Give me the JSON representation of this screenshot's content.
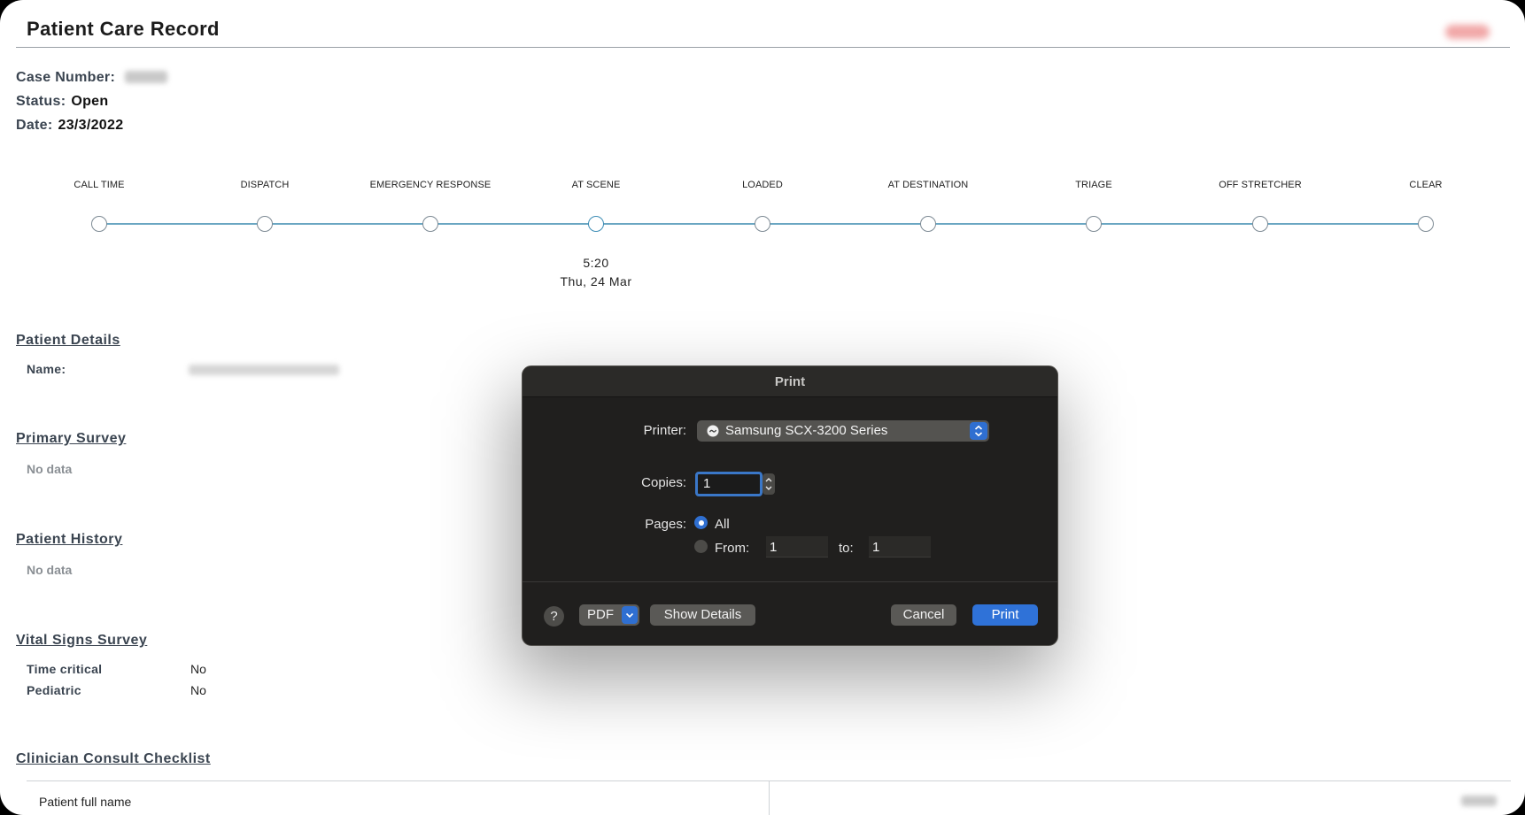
{
  "header": {
    "title": "Patient Care Record"
  },
  "case": {
    "case_number_label": "Case Number:",
    "status_label": "Status:",
    "status_value": "Open",
    "date_label": "Date:",
    "date_value": "23/3/2022"
  },
  "timeline": {
    "stages": [
      "CALL TIME",
      "DISPATCH",
      "EMERGENCY RESPONSE",
      "AT SCENE",
      "LOADED",
      "AT DESTINATION",
      "TRIAGE",
      "OFF STRETCHER",
      "CLEAR"
    ],
    "active_stage": "AT SCENE",
    "active_time": "5:20",
    "active_date": "Thu, 24 Mar"
  },
  "sections": {
    "patient_details": {
      "heading": "Patient Details",
      "name_label": "Name:"
    },
    "primary_survey": {
      "heading": "Primary Survey",
      "empty_text": "No data"
    },
    "patient_history": {
      "heading": "Patient History",
      "empty_text": "No data"
    },
    "vital_signs": {
      "heading": "Vital Signs Survey",
      "rows": [
        {
          "label": "Time critical",
          "value": "No"
        },
        {
          "label": "Pediatric",
          "value": "No"
        }
      ]
    },
    "clinician_checklist": {
      "heading": "Clinician Consult Checklist",
      "row_label": "Patient full name"
    }
  },
  "print_dialog": {
    "title": "Print",
    "printer_label": "Printer:",
    "printer_value": "Samsung SCX-3200 Series",
    "copies_label": "Copies:",
    "copies_value": "1",
    "pages_label": "Pages:",
    "all_label": "All",
    "from_label": "From:",
    "from_value": "1",
    "to_label": "to:",
    "to_value": "1",
    "help_label": "?",
    "pdf_label": "PDF",
    "show_details_label": "Show Details",
    "cancel_label": "Cancel",
    "print_label": "Print"
  },
  "colors": {
    "accent": "#2f72d8",
    "timeline_line": "#6aa6c2",
    "dialog_bg": "#201f1e"
  }
}
